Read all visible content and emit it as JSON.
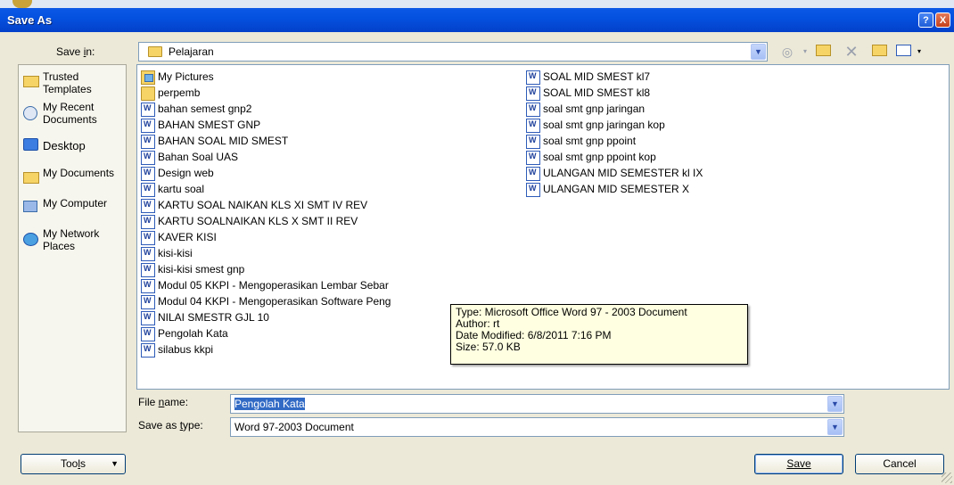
{
  "window": {
    "title": "Save As",
    "help_label": "?",
    "close_label": "X"
  },
  "save_in": {
    "label": "Save in:",
    "value": "Pelajaran"
  },
  "toolbar": {
    "back_icon": "back-icon",
    "up_icon": "up-folder-icon",
    "delete_icon": "delete-icon",
    "new_folder_icon": "new-folder-icon",
    "views_icon": "views-icon"
  },
  "places": [
    {
      "label": "Trusted Templates",
      "icon": "folder-icon"
    },
    {
      "label": "My Recent Documents",
      "icon": "recent-documents-icon"
    },
    {
      "label": "Desktop",
      "icon": "desktop-icon"
    },
    {
      "label": "My Documents",
      "icon": "my-documents-icon"
    },
    {
      "label": "My Computer",
      "icon": "computer-icon"
    },
    {
      "label": "My Network Places",
      "icon": "network-icon"
    }
  ],
  "files_col1": [
    {
      "name": "My Pictures",
      "type": "pictures-folder"
    },
    {
      "name": "perpemb",
      "type": "folder"
    },
    {
      "name": "bahan semest gnp2",
      "type": "word"
    },
    {
      "name": "BAHAN SMEST GNP",
      "type": "word"
    },
    {
      "name": "BAHAN SOAL MID SMEST",
      "type": "word"
    },
    {
      "name": "Bahan Soal UAS",
      "type": "word"
    },
    {
      "name": "Design web",
      "type": "word"
    },
    {
      "name": "kartu soal",
      "type": "word"
    },
    {
      "name": "KARTU SOAL NAIKAN KLS XI SMT IV REV",
      "type": "word"
    },
    {
      "name": "KARTU SOALNAIKAN KLS X SMT II REV",
      "type": "word"
    },
    {
      "name": "KAVER KISI",
      "type": "word"
    },
    {
      "name": "kisi-kisi",
      "type": "word"
    },
    {
      "name": "kisi-kisi smest gnp",
      "type": "word"
    },
    {
      "name": "Modul 05 KKPI - Mengoperasikan Lembar Sebar",
      "type": "word"
    },
    {
      "name": "Modul  04 KKPI - Mengoperasikan Software Peng",
      "type": "word"
    },
    {
      "name": "NILAI SMESTR GJL 10",
      "type": "word"
    },
    {
      "name": "Pengolah Kata",
      "type": "word"
    },
    {
      "name": "silabus kkpi",
      "type": "word"
    }
  ],
  "files_col2": [
    {
      "name": "SOAL MID SMEST kl7",
      "type": "word"
    },
    {
      "name": "SOAL MID SMEST kl8",
      "type": "word"
    },
    {
      "name": "soal smt gnp jaringan",
      "type": "word"
    },
    {
      "name": "soal smt gnp jaringan kop",
      "type": "word"
    },
    {
      "name": "soal smt gnp ppoint",
      "type": "word"
    },
    {
      "name": "soal smt gnp ppoint kop",
      "type": "word"
    },
    {
      "name": "ULANGAN MID SEMESTER kl IX",
      "type": "word"
    },
    {
      "name": "ULANGAN MID SEMESTER X",
      "type": "word"
    }
  ],
  "tooltip": {
    "type": "Type: Microsoft Office Word 97 - 2003 Document",
    "author": "Author: rt",
    "modified": "Date Modified: 6/8/2011 7:16 PM",
    "size": "Size: 57.0 KB"
  },
  "file_name": {
    "label": "File name:",
    "value": "Pengolah Kata"
  },
  "save_type": {
    "label": "Save as type:",
    "value": "Word 97-2003 Document"
  },
  "buttons": {
    "tools": "Tools",
    "save": "Save",
    "cancel": "Cancel"
  },
  "colors": {
    "titlebar": "#0451e0",
    "selection": "#316ac5",
    "tooltip_bg": "#ffffe1",
    "dialog_bg": "#ece9d8"
  }
}
